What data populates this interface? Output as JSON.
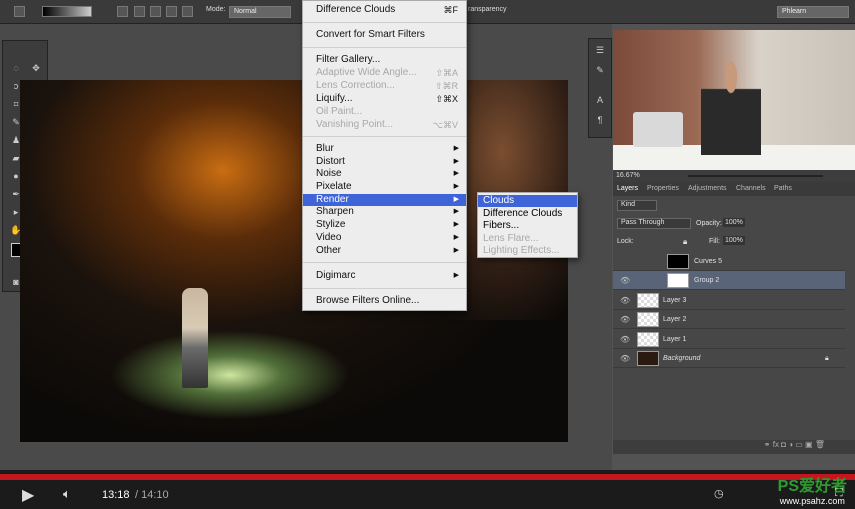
{
  "options_bar": {
    "mode_label": "Mode:",
    "mode_value": "Normal",
    "transparency_label": "ransparency",
    "workspace": "Phlearn"
  },
  "filter_menu": {
    "items": [
      {
        "label": "Difference Clouds",
        "shortcut": "⌘F",
        "disabled": false
      },
      {
        "label": "Convert for Smart Filters",
        "disabled": false
      },
      {
        "label": "Filter Gallery...",
        "disabled": false
      },
      {
        "label": "Adaptive Wide Angle...",
        "shortcut": "⇧⌘A",
        "disabled": true
      },
      {
        "label": "Lens Correction...",
        "shortcut": "⇧⌘R",
        "disabled": true
      },
      {
        "label": "Liquify...",
        "shortcut": "⇧⌘X",
        "disabled": false
      },
      {
        "label": "Oil Paint...",
        "disabled": true
      },
      {
        "label": "Vanishing Point...",
        "shortcut": "⌥⌘V",
        "disabled": true
      },
      {
        "label": "Blur",
        "submenu": true
      },
      {
        "label": "Distort",
        "submenu": true
      },
      {
        "label": "Noise",
        "submenu": true
      },
      {
        "label": "Pixelate",
        "submenu": true
      },
      {
        "label": "Render",
        "submenu": true,
        "highlighted": true
      },
      {
        "label": "Sharpen",
        "submenu": true
      },
      {
        "label": "Stylize",
        "submenu": true
      },
      {
        "label": "Video",
        "submenu": true
      },
      {
        "label": "Other",
        "submenu": true
      },
      {
        "label": "Digimarc",
        "submenu": true
      },
      {
        "label": "Browse Filters Online..."
      }
    ],
    "render_submenu": [
      {
        "label": "Clouds",
        "highlighted": true
      },
      {
        "label": "Difference Clouds"
      },
      {
        "label": "Fibers..."
      },
      {
        "label": "Lens Flare...",
        "disabled": true
      },
      {
        "label": "Lighting Effects...",
        "disabled": true
      }
    ]
  },
  "navigator": {
    "zoom": "16.67%"
  },
  "layers_panel": {
    "tabs": [
      "Layers",
      "Properties",
      "Adjustments",
      "Channels",
      "Paths"
    ],
    "kind": "Kind",
    "blend_mode": "Pass Through",
    "opacity_label": "Opacity:",
    "opacity": "100%",
    "lock_label": "Lock:",
    "fill_label": "Fill:",
    "fill": "100%",
    "layers": [
      {
        "name": "Curves 5",
        "visible": false
      },
      {
        "name": "Group 2",
        "visible": true,
        "selected": true
      },
      {
        "name": "Layer 3",
        "visible": true
      },
      {
        "name": "Layer 2",
        "visible": true
      },
      {
        "name": "Layer 1",
        "visible": true
      },
      {
        "name": "Background",
        "visible": true,
        "locked": true
      }
    ]
  },
  "player": {
    "current_time": "13:18",
    "duration": "/ 14:10",
    "progress_color": "#c4161c",
    "watermark_brand": "PS爱好者",
    "watermark_url": "www.psahz.com"
  }
}
